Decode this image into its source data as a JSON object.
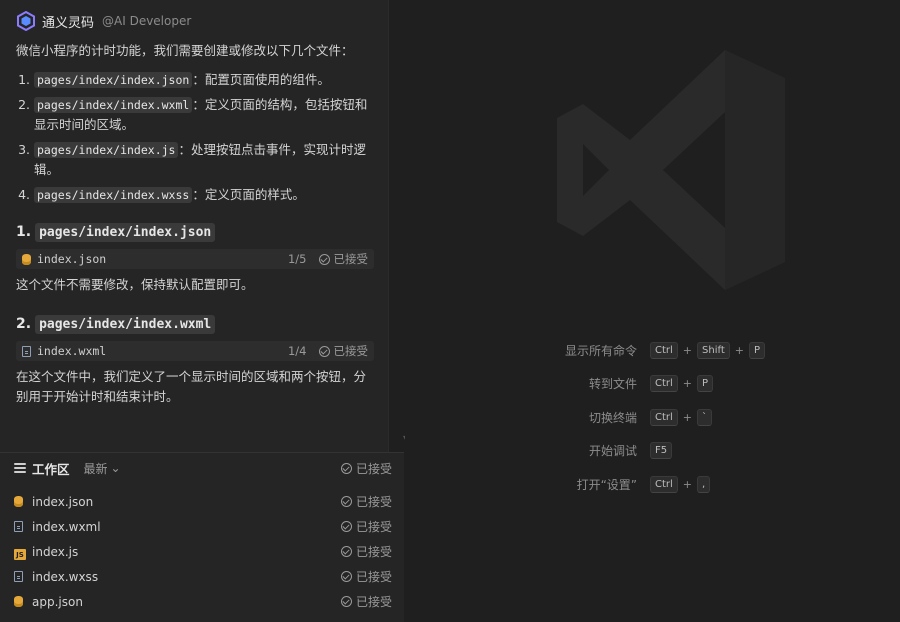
{
  "chat": {
    "assistant_name": "通义灵码",
    "assistant_sub": "@AI Developer",
    "intro": "微信小程序的计时功能，我们需要创建或修改以下几个文件：",
    "files": [
      {
        "path": "pages/index/index.json",
        "desc": "：配置页面使用的组件。"
      },
      {
        "path": "pages/index/index.wxml",
        "desc": "：定义页面的结构，包括按钮和显示时间的区域。"
      },
      {
        "path": "pages/index/index.js",
        "desc": "：处理按钮点击事件，实现计时逻辑。"
      },
      {
        "path": "pages/index/index.wxss",
        "desc": "：定义页面的样式。"
      }
    ],
    "sections": [
      {
        "heading_num": "1.",
        "heading_path": "pages/index/index.json",
        "card_name": "index.json",
        "card_count": "1/5",
        "card_status": "已接受",
        "text": "这个文件不需要修改，保持默认配置即可。"
      },
      {
        "heading_num": "2.",
        "heading_path": "pages/index/index.wxml",
        "card_name": "index.wxml",
        "card_count": "1/4",
        "card_status": "已接受",
        "text": "在这个文件中，我们定义了一个显示时间的区域和两个按钮，分别用于开始计时和结束计时。"
      }
    ]
  },
  "workspace": {
    "title": "工作区",
    "filter": "最新",
    "status": "已接受",
    "files": [
      {
        "name": "index.json",
        "icon": "json-file-icon",
        "status": "已接受"
      },
      {
        "name": "index.wxml",
        "icon": "wxml-file-icon",
        "status": "已接受"
      },
      {
        "name": "index.js",
        "icon": "js-file-icon",
        "status": "已接受"
      },
      {
        "name": "index.wxss",
        "icon": "wxss-file-icon",
        "status": "已接受"
      },
      {
        "name": "app.json",
        "icon": "json-file-icon",
        "status": "已接受"
      }
    ]
  },
  "shortcuts": [
    {
      "label": "显示所有命令",
      "keys": [
        "Ctrl",
        "Shift",
        "P"
      ]
    },
    {
      "label": "转到文件",
      "keys": [
        "Ctrl",
        "P"
      ]
    },
    {
      "label": "切换终端",
      "keys": [
        "Ctrl",
        "`"
      ]
    },
    {
      "label": "开始调试",
      "keys": [
        "F5"
      ]
    },
    {
      "label": "打开“设置”",
      "keys": [
        "Ctrl",
        ","
      ]
    }
  ],
  "colors": {
    "background": "#1f1f1f",
    "panel": "#252526",
    "accent_file": "#e5a93b",
    "logo_watermark": "#2a2a2a"
  }
}
